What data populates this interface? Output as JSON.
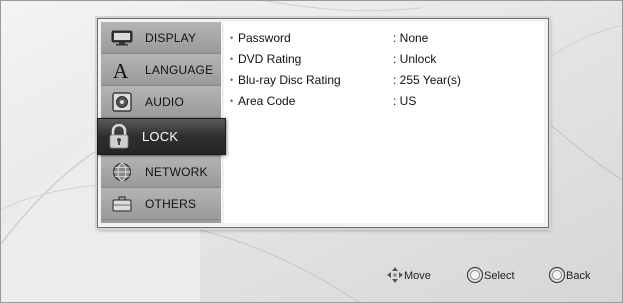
{
  "sidebar": {
    "items": [
      {
        "label": "DISPLAY",
        "icon": "display-icon",
        "active": false
      },
      {
        "label": "LANGUAGE",
        "icon": "language-icon",
        "active": false
      },
      {
        "label": "AUDIO",
        "icon": "audio-icon",
        "active": false
      },
      {
        "label": "LOCK",
        "icon": "lock-icon",
        "active": true
      },
      {
        "label": "NETWORK",
        "icon": "network-icon",
        "active": false
      },
      {
        "label": "OTHERS",
        "icon": "others-icon",
        "active": false
      }
    ]
  },
  "settings": [
    {
      "name": "Password",
      "value": ": None"
    },
    {
      "name": "DVD Rating",
      "value": ": Unlock"
    },
    {
      "name": "Blu-ray Disc Rating",
      "value": ": 255 Year(s)"
    },
    {
      "name": "Area Code",
      "value": ": US"
    }
  ],
  "hints": {
    "move": "Move",
    "select": "Select",
    "back": "Back"
  },
  "colors": {
    "active_item": "#2e2e2e",
    "sidebar_item": "#a8a8a8",
    "content_bg": "#ffffff",
    "background": "#e6e6e6"
  }
}
